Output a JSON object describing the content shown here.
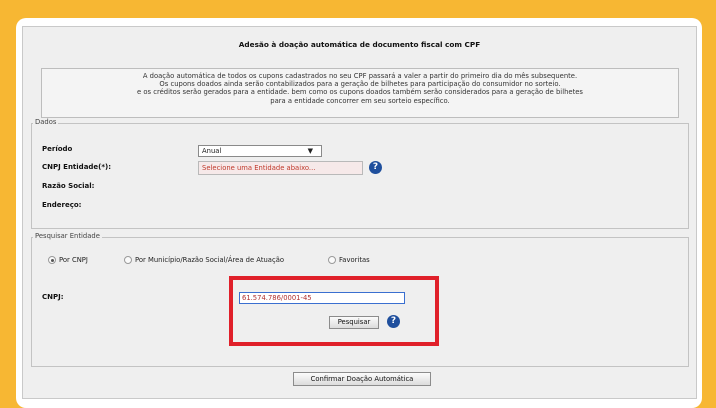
{
  "title": "Adesão à doação automática de documento fiscal com CPF",
  "notice_lines": [
    "A doação automática de todos os cupons cadastrados no seu CPF passará a valer a partir do primeiro dia do mês subsequente.",
    "Os cupons doados ainda serão contabilizados para a geração de bilhetes para participação do consumidor no sorteio.",
    "e os créditos serão gerados para a entidade. bem como os cupons doados também serão considerados para a geração de bilhetes",
    "para a entidade concorrer em seu sorteio específico."
  ],
  "dados": {
    "legend": "Dados",
    "periodo_label": "Período",
    "periodo_value": "Anual",
    "cnpj_entidade_label": "CNPJ Entidade(*):",
    "cnpj_entidade_value": "Selecione uma Entidade abaixo...",
    "razao_social_label": "Razão Social:",
    "endereco_label": "Endereço:"
  },
  "pesquisar": {
    "legend": "Pesquisar Entidade",
    "options": [
      "Por CNPJ",
      "Por Município/Razão Social/Área de Atuação",
      "Favoritas"
    ],
    "selected_index": 0,
    "cnpj_label": "CNPJ:",
    "cnpj_value": "61.574.786/0001-45",
    "search_button": "Pesquisar"
  },
  "confirm_button": "Confirmar Doação Automática",
  "help_glyph": "?",
  "select_arrow": "▼",
  "colors": {
    "background": "#f7b733",
    "highlight": "#e0202a",
    "help_icon": "#1f4f9d",
    "error_text": "#c0392b"
  }
}
